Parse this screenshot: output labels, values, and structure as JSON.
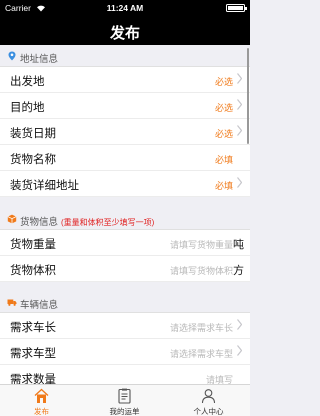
{
  "status_bar": {
    "carrier": "Carrier",
    "time": "11:24 AM"
  },
  "nav": {
    "title": "发布"
  },
  "sections": {
    "address": {
      "title": "地址信息"
    },
    "cargo": {
      "title": "货物信息",
      "note": "(重量和体积至少填写一项)"
    },
    "vehicle": {
      "title": "车辆信息"
    }
  },
  "rows": {
    "departure": {
      "label": "出发地",
      "status": "必选"
    },
    "destination": {
      "label": "目的地",
      "status": "必选"
    },
    "load_date": {
      "label": "装货日期",
      "status": "必选"
    },
    "cargo_name": {
      "label": "货物名称",
      "status": "必填"
    },
    "load_address": {
      "label": "装货详细地址",
      "status": "必填"
    },
    "cargo_weight": {
      "label": "货物重量",
      "placeholder": "请填写货物重量",
      "unit": "吨"
    },
    "cargo_volume": {
      "label": "货物体积",
      "placeholder": "请填写货物体积",
      "unit": "方"
    },
    "vehicle_length": {
      "label": "需求车长",
      "placeholder": "请选择需求车长"
    },
    "vehicle_type": {
      "label": "需求车型",
      "placeholder": "请选择需求车型"
    },
    "vehicle_count": {
      "label": "需求数量",
      "placeholder": "请填写"
    }
  },
  "tab_bar": {
    "tabs": [
      {
        "label": "发布",
        "icon": "house-icon",
        "active": true
      },
      {
        "label": "我的运单",
        "icon": "waybill-icon",
        "active": false
      },
      {
        "label": "个人中心",
        "icon": "person-icon",
        "active": false
      }
    ]
  },
  "colors": {
    "accent": "#f07a1a",
    "nav_bg": "#000000",
    "note_red": "#e02020",
    "section_bg": "#efeff4"
  }
}
